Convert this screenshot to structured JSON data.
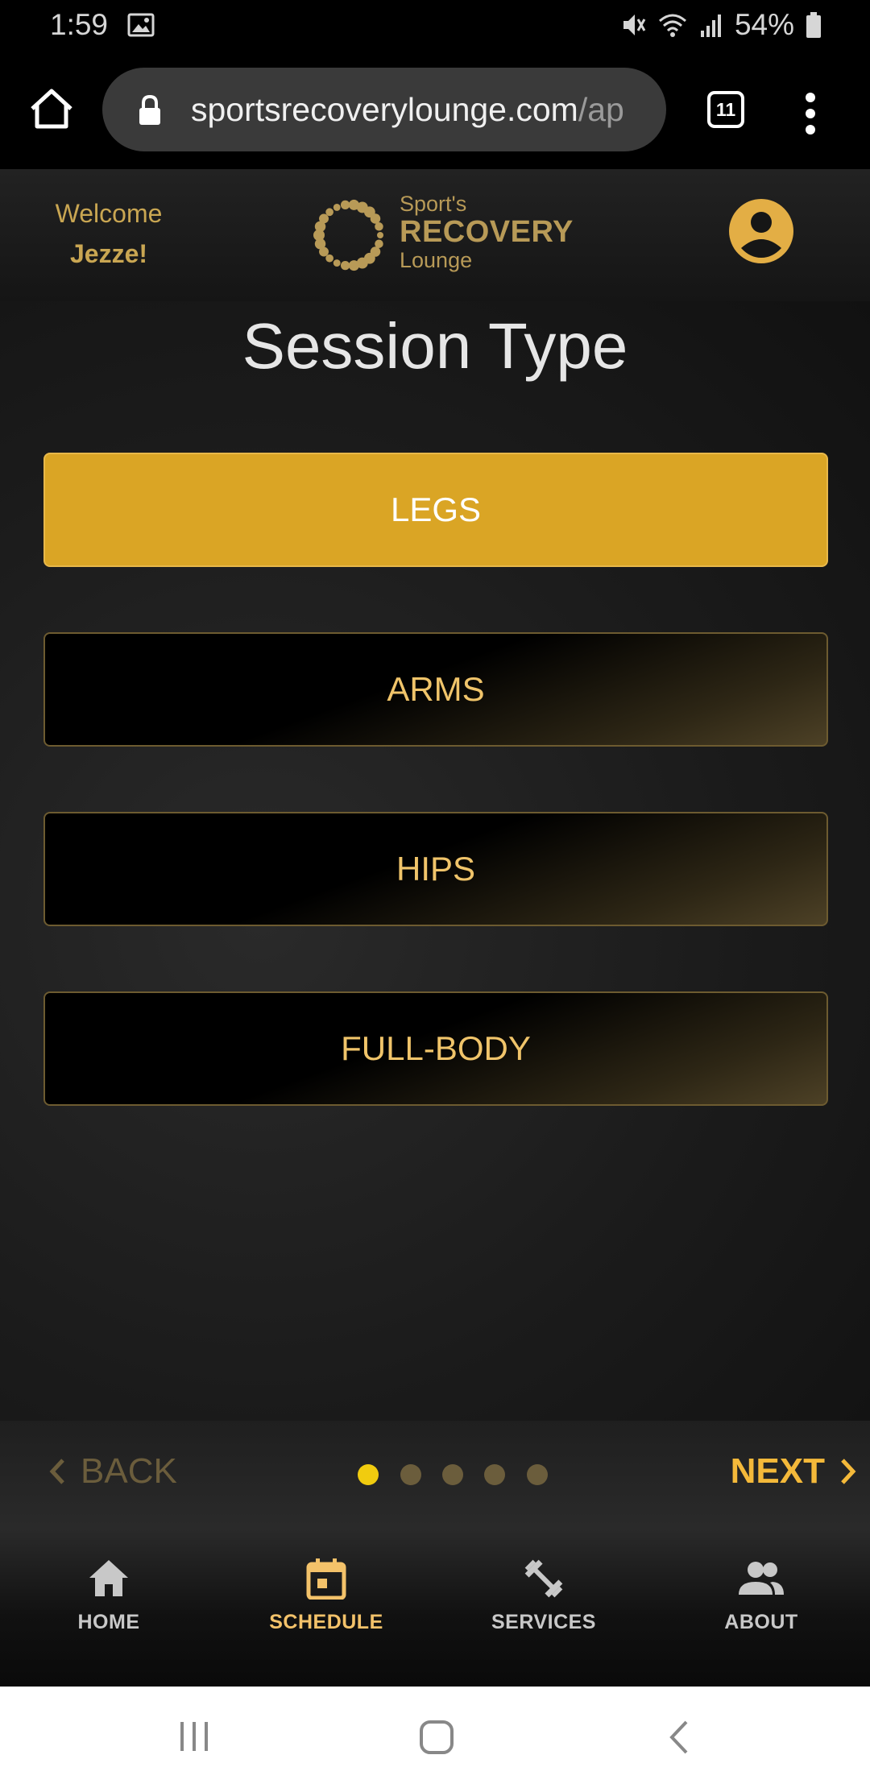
{
  "status_bar": {
    "time": "1:59",
    "battery": "54%"
  },
  "browser": {
    "url_domain": "sportsrecoverylounge.com",
    "url_path": "/ap",
    "tab_count": "11"
  },
  "header": {
    "welcome_label": "Welcome",
    "welcome_name": "Jezze!",
    "logo": {
      "line1": "Sport's",
      "line2": "RECOVERY",
      "line3": "Lounge"
    }
  },
  "page": {
    "title": "Session Type"
  },
  "session_options": [
    {
      "label": "LEGS",
      "selected": true
    },
    {
      "label": "ARMS",
      "selected": false
    },
    {
      "label": "HIPS",
      "selected": false
    },
    {
      "label": "FULL-BODY",
      "selected": false
    }
  ],
  "stepper": {
    "back_label": "BACK",
    "next_label": "NEXT",
    "total_steps": 5,
    "current_step": 1
  },
  "bottom_nav": [
    {
      "label": "HOME",
      "icon": "home-icon",
      "active": false
    },
    {
      "label": "SCHEDULE",
      "icon": "calendar-icon",
      "active": true
    },
    {
      "label": "SERVICES",
      "icon": "dumbbell-icon",
      "active": false
    },
    {
      "label": "ABOUT",
      "icon": "people-icon",
      "active": false
    }
  ],
  "colors": {
    "accent": "#daa525",
    "gold_text": "#f0c46a",
    "header_gold": "#c9a652",
    "inactive_nav": "#c8c8c8"
  }
}
